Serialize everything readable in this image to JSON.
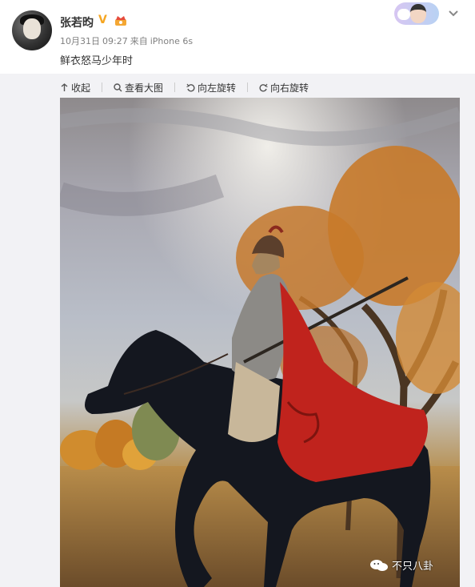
{
  "post": {
    "username": "张若昀",
    "verified_icon": "verified-v-icon",
    "level_icon": "crown-badge-icon",
    "date": "10月31日",
    "time": "09:27",
    "source_prefix": "来自",
    "source": "iPhone 6s",
    "text": "鲜衣怒马少年时"
  },
  "toolbar": {
    "collapse": "收起",
    "view_large": "查看大图",
    "rotate_left": "向左旋转",
    "rotate_right": "向右旋转"
  },
  "watermark": {
    "text": "不只八卦",
    "icon": "wechat-icon"
  },
  "colors": {
    "cape": "#c0231d",
    "autumn_tree": "#c87a2a",
    "horse": "#14171f",
    "background": "#f2f2f5"
  }
}
